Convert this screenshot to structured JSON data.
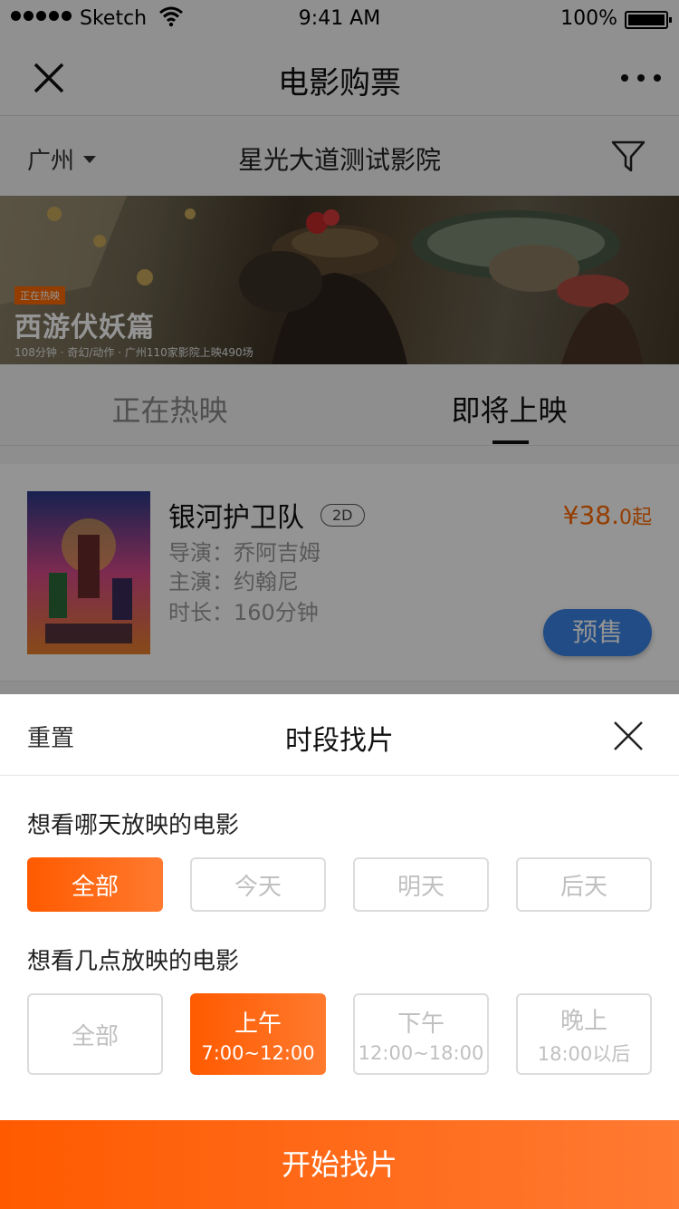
{
  "status_bar": {
    "carrier": "Sketch",
    "time": "9:41 AM",
    "battery": "100%"
  },
  "nav": {
    "title": "电影购票"
  },
  "filter": {
    "city": "广州",
    "cinema": "星光大道测试影院"
  },
  "banner": {
    "tag": "正在热映",
    "title": "西游伏妖篇",
    "meta": "108分钟 · 奇幻/动作 · 广州110家影院上映490场"
  },
  "tabs": {
    "now_showing": "正在热映",
    "coming_soon": "即将上映"
  },
  "movie": {
    "title": "银河护卫队",
    "format": "2D",
    "director": "导演：乔阿吉姆",
    "actor": "主演：约翰尼",
    "duration": "时长：160分钟",
    "price_main": "¥38.",
    "price_suffix": "0起",
    "action": "预售"
  },
  "sheet": {
    "reset": "重置",
    "title": "时段找片",
    "day_question": "想看哪天放映的电影",
    "days": [
      "全部",
      "今天",
      "明天",
      "后天"
    ],
    "selected_day": 0,
    "time_question": "想看几点放映的电影",
    "slots": [
      {
        "label": "全部",
        "range": ""
      },
      {
        "label": "上午",
        "range": "7:00~12:00"
      },
      {
        "label": "下午",
        "range": "12:00~18:00"
      },
      {
        "label": "晚上",
        "range": "18:00以后"
      }
    ],
    "selected_slot": 1,
    "submit": "开始找片"
  },
  "colors": {
    "accent": "#ff6a00",
    "presale_blue": "#3a84e6"
  }
}
